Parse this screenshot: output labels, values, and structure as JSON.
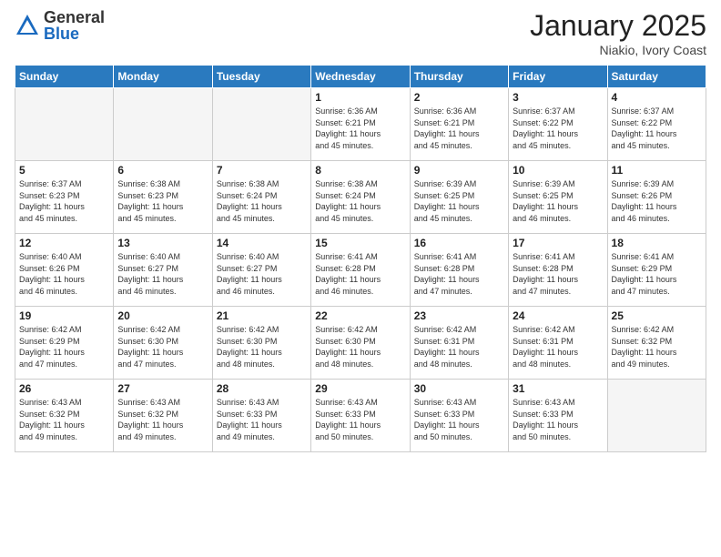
{
  "header": {
    "logo_general": "General",
    "logo_blue": "Blue",
    "month_title": "January 2025",
    "location": "Niakio, Ivory Coast"
  },
  "weekdays": [
    "Sunday",
    "Monday",
    "Tuesday",
    "Wednesday",
    "Thursday",
    "Friday",
    "Saturday"
  ],
  "weeks": [
    [
      {
        "day": "",
        "info": ""
      },
      {
        "day": "",
        "info": ""
      },
      {
        "day": "",
        "info": ""
      },
      {
        "day": "1",
        "info": "Sunrise: 6:36 AM\nSunset: 6:21 PM\nDaylight: 11 hours\nand 45 minutes."
      },
      {
        "day": "2",
        "info": "Sunrise: 6:36 AM\nSunset: 6:21 PM\nDaylight: 11 hours\nand 45 minutes."
      },
      {
        "day": "3",
        "info": "Sunrise: 6:37 AM\nSunset: 6:22 PM\nDaylight: 11 hours\nand 45 minutes."
      },
      {
        "day": "4",
        "info": "Sunrise: 6:37 AM\nSunset: 6:22 PM\nDaylight: 11 hours\nand 45 minutes."
      }
    ],
    [
      {
        "day": "5",
        "info": "Sunrise: 6:37 AM\nSunset: 6:23 PM\nDaylight: 11 hours\nand 45 minutes."
      },
      {
        "day": "6",
        "info": "Sunrise: 6:38 AM\nSunset: 6:23 PM\nDaylight: 11 hours\nand 45 minutes."
      },
      {
        "day": "7",
        "info": "Sunrise: 6:38 AM\nSunset: 6:24 PM\nDaylight: 11 hours\nand 45 minutes."
      },
      {
        "day": "8",
        "info": "Sunrise: 6:38 AM\nSunset: 6:24 PM\nDaylight: 11 hours\nand 45 minutes."
      },
      {
        "day": "9",
        "info": "Sunrise: 6:39 AM\nSunset: 6:25 PM\nDaylight: 11 hours\nand 45 minutes."
      },
      {
        "day": "10",
        "info": "Sunrise: 6:39 AM\nSunset: 6:25 PM\nDaylight: 11 hours\nand 46 minutes."
      },
      {
        "day": "11",
        "info": "Sunrise: 6:39 AM\nSunset: 6:26 PM\nDaylight: 11 hours\nand 46 minutes."
      }
    ],
    [
      {
        "day": "12",
        "info": "Sunrise: 6:40 AM\nSunset: 6:26 PM\nDaylight: 11 hours\nand 46 minutes."
      },
      {
        "day": "13",
        "info": "Sunrise: 6:40 AM\nSunset: 6:27 PM\nDaylight: 11 hours\nand 46 minutes."
      },
      {
        "day": "14",
        "info": "Sunrise: 6:40 AM\nSunset: 6:27 PM\nDaylight: 11 hours\nand 46 minutes."
      },
      {
        "day": "15",
        "info": "Sunrise: 6:41 AM\nSunset: 6:28 PM\nDaylight: 11 hours\nand 46 minutes."
      },
      {
        "day": "16",
        "info": "Sunrise: 6:41 AM\nSunset: 6:28 PM\nDaylight: 11 hours\nand 47 minutes."
      },
      {
        "day": "17",
        "info": "Sunrise: 6:41 AM\nSunset: 6:28 PM\nDaylight: 11 hours\nand 47 minutes."
      },
      {
        "day": "18",
        "info": "Sunrise: 6:41 AM\nSunset: 6:29 PM\nDaylight: 11 hours\nand 47 minutes."
      }
    ],
    [
      {
        "day": "19",
        "info": "Sunrise: 6:42 AM\nSunset: 6:29 PM\nDaylight: 11 hours\nand 47 minutes."
      },
      {
        "day": "20",
        "info": "Sunrise: 6:42 AM\nSunset: 6:30 PM\nDaylight: 11 hours\nand 47 minutes."
      },
      {
        "day": "21",
        "info": "Sunrise: 6:42 AM\nSunset: 6:30 PM\nDaylight: 11 hours\nand 48 minutes."
      },
      {
        "day": "22",
        "info": "Sunrise: 6:42 AM\nSunset: 6:30 PM\nDaylight: 11 hours\nand 48 minutes."
      },
      {
        "day": "23",
        "info": "Sunrise: 6:42 AM\nSunset: 6:31 PM\nDaylight: 11 hours\nand 48 minutes."
      },
      {
        "day": "24",
        "info": "Sunrise: 6:42 AM\nSunset: 6:31 PM\nDaylight: 11 hours\nand 48 minutes."
      },
      {
        "day": "25",
        "info": "Sunrise: 6:42 AM\nSunset: 6:32 PM\nDaylight: 11 hours\nand 49 minutes."
      }
    ],
    [
      {
        "day": "26",
        "info": "Sunrise: 6:43 AM\nSunset: 6:32 PM\nDaylight: 11 hours\nand 49 minutes."
      },
      {
        "day": "27",
        "info": "Sunrise: 6:43 AM\nSunset: 6:32 PM\nDaylight: 11 hours\nand 49 minutes."
      },
      {
        "day": "28",
        "info": "Sunrise: 6:43 AM\nSunset: 6:33 PM\nDaylight: 11 hours\nand 49 minutes."
      },
      {
        "day": "29",
        "info": "Sunrise: 6:43 AM\nSunset: 6:33 PM\nDaylight: 11 hours\nand 50 minutes."
      },
      {
        "day": "30",
        "info": "Sunrise: 6:43 AM\nSunset: 6:33 PM\nDaylight: 11 hours\nand 50 minutes."
      },
      {
        "day": "31",
        "info": "Sunrise: 6:43 AM\nSunset: 6:33 PM\nDaylight: 11 hours\nand 50 minutes."
      },
      {
        "day": "",
        "info": ""
      }
    ]
  ]
}
